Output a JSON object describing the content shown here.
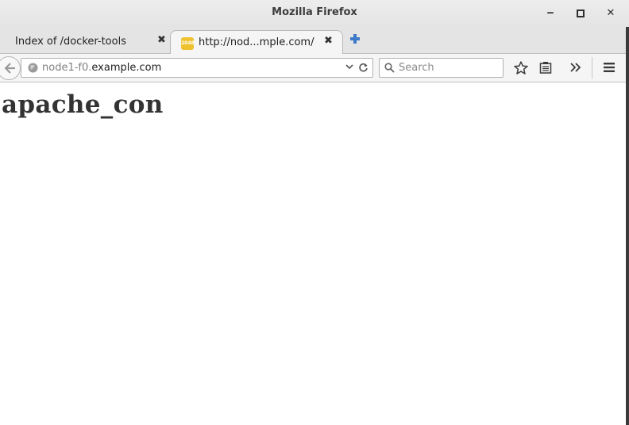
{
  "window": {
    "title": "Mozilla Firefox",
    "minimize_glyph": "‒",
    "maximize_glyph": "□",
    "close_glyph": "✕"
  },
  "tabs": [
    {
      "label": "Index of /docker-tools",
      "active": false,
      "close_glyph": "✖"
    },
    {
      "label": "http://nod...mple.com/",
      "active": true,
      "favicon_text": "2048",
      "close_glyph": "✖"
    }
  ],
  "navbar": {
    "url_prefix": "node1-f0.",
    "url_domain": "example.com",
    "search_placeholder": "Search"
  },
  "icons": {
    "back": "back-arrow-icon",
    "globe": "globe-icon",
    "dropdown": "chevron-down-icon",
    "reload": "reload-icon",
    "search": "magnifier-icon",
    "bookmark": "star-icon",
    "reading_list": "clipboard-icon",
    "overflow": "double-chevron-icon",
    "menu": "hamburger-menu-icon",
    "new_tab": "plus-icon"
  },
  "colors": {
    "new_tab_plus": "#3d7bc9",
    "favicon": "#edc22e",
    "heading": "#333333"
  },
  "page": {
    "heading": "apache_con"
  }
}
